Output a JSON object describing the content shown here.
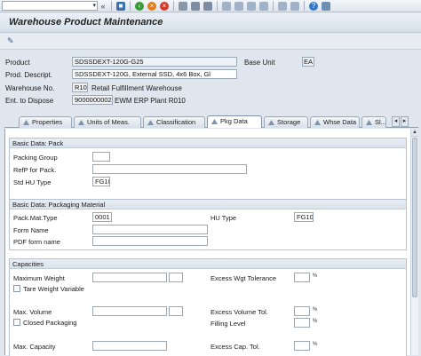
{
  "toolbar": {
    "command_field_value": "",
    "icons": [
      "save-icon",
      "back-icon",
      "exit-icon",
      "cancel-icon",
      "print-icon",
      "find-icon",
      "find-next-icon",
      "first-page-icon",
      "prev-page-icon",
      "next-page-icon",
      "last-page-icon",
      "create-session-icon",
      "shortcut-icon",
      "help-icon",
      "layout-icon"
    ]
  },
  "title": "Warehouse Product Maintenance",
  "header": {
    "product_label": "Product",
    "product_value": "SDSSDEXT-120G-G25",
    "base_unit_label": "Base Unit",
    "base_unit_value": "EA",
    "prod_descript_label": "Prod. Descript.",
    "prod_descript_value": "SDSSDEXT-120G, External SSD, 4x6 Box, Gl",
    "warehouse_label": "Warehouse No.",
    "warehouse_value": "R10",
    "warehouse_text": "Retail Fulfillment Warehouse",
    "ent_dispose_label": "Ent. to Dispose",
    "ent_dispose_value": "9000000002",
    "ent_dispose_text": "EWM ERP Plant R010"
  },
  "tabs": [
    {
      "label": "Properties",
      "active": false
    },
    {
      "label": "Units of Meas.",
      "active": false
    },
    {
      "label": "Classification",
      "active": false
    },
    {
      "label": "Pkg Data",
      "active": true
    },
    {
      "label": "Storage",
      "active": false
    },
    {
      "label": "Whse Data",
      "active": false
    },
    {
      "label": "Sl...",
      "active": false
    }
  ],
  "basic_pack": {
    "title": "Basic Data: Pack",
    "packing_group_label": "Packing Group",
    "packing_group_value": "",
    "refp_label": "RefP for Pack.",
    "refp_value": "",
    "std_hu_label": "Std HU Type",
    "std_hu_value": "FG10"
  },
  "basic_packaging": {
    "title": "Basic Data: Packaging Material",
    "pack_mat_type_label": "Pack.Mat.Type",
    "pack_mat_type_value": "0001",
    "hu_type_label": "HU Type",
    "hu_type_value": "FG10",
    "form_name_label": "Form Name",
    "form_name_value": "",
    "pdf_form_label": "PDF form name",
    "pdf_form_value": ""
  },
  "capacities": {
    "title": "Capacities",
    "max_weight_label": "Maximum Weight",
    "tare_weight_label": "Tare Weight Variable",
    "excess_wgt_label": "Excess Wgt Tolerance",
    "max_volume_label": "Max. Volume",
    "excess_vol_label": "Excess Volume Tol.",
    "closed_packaging_label": "Closed Packaging",
    "filling_level_label": "Filling Level",
    "max_capacity_label": "Max. Capacity",
    "excess_cap_label": "Excess Cap. Tol."
  }
}
